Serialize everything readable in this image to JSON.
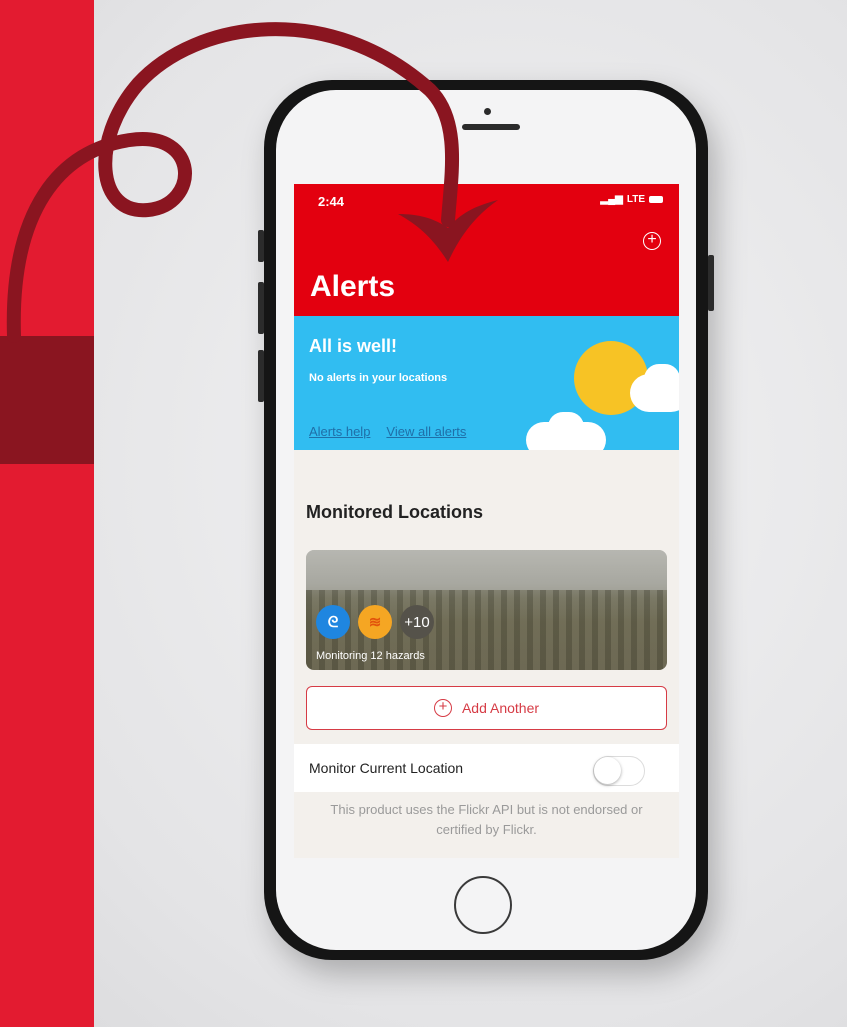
{
  "status_bar": {
    "time": "2:44",
    "carrier": "LTE"
  },
  "header": {
    "title": "Alerts",
    "add_icon": "plus-circle-icon"
  },
  "banner": {
    "title": "All is well!",
    "subtitle": "No alerts in your locations",
    "links": [
      "Alerts help",
      "View all alerts"
    ]
  },
  "monitored": {
    "title": "Monitored Locations",
    "extra_count": "+10",
    "caption": "Monitoring 12 hazards",
    "hazard_icons": [
      "hurricane-icon",
      "flood-icon"
    ]
  },
  "add_another": {
    "label": "Add Another"
  },
  "current_location": {
    "label": "Monitor Current Location",
    "enabled": false
  },
  "disclaimer": "This product uses the Flickr API but is not endorsed or certified by Flickr.",
  "colors": {
    "header_red": "#e3000f",
    "banner_blue": "#31bdf1",
    "band_red": "#e31b30",
    "ribbon": "#8a1520"
  }
}
